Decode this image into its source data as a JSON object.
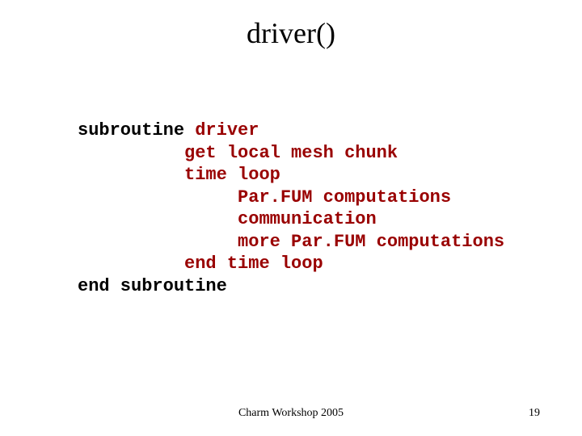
{
  "title": "driver()",
  "code": {
    "l1_kw": "subroutine",
    "l1_name": " driver",
    "indent1": "          ",
    "indent2": "               ",
    "l2": "get local mesh chunk",
    "l3": "time loop",
    "l4": "Par.FUM computations",
    "l5": "communication",
    "l6": "more Par.FUM computations",
    "l7": "end time loop",
    "l8_kw": "end subroutine"
  },
  "footer": {
    "center": "Charm Workshop 2005",
    "page": "19"
  }
}
